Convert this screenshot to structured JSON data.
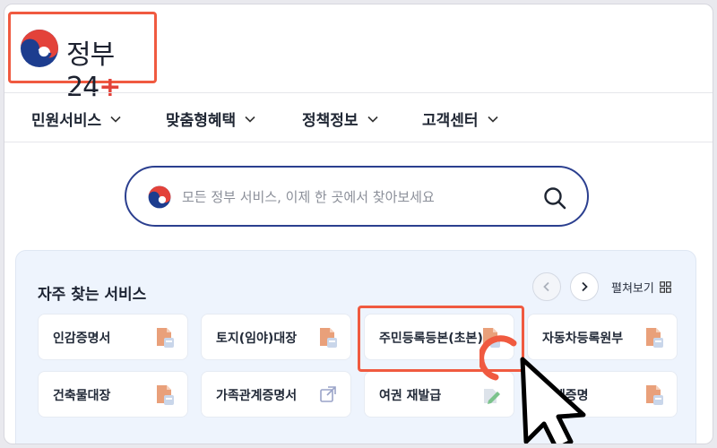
{
  "brand": {
    "name": "정부",
    "number": "24",
    "plus": "+"
  },
  "nav": {
    "items": [
      {
        "label": "민원서비스"
      },
      {
        "label": "맞춤형혜택"
      },
      {
        "label": "정책정보"
      },
      {
        "label": "고객센터"
      }
    ]
  },
  "search": {
    "placeholder": "모든 정부 서비스, 이제 한 곳에서 찾아보세요",
    "value": ""
  },
  "services": {
    "title": "자주 찾는 서비스",
    "expand_label": "펼쳐보기",
    "cards": [
      {
        "label": "인감증명서",
        "icon": "document-icon"
      },
      {
        "label": "토지(임야)대장",
        "icon": "document-icon"
      },
      {
        "label": "주민등록등본(초본)",
        "icon": "document-icon"
      },
      {
        "label": "자동차등록원부",
        "icon": "document-icon"
      },
      {
        "label": "건축물대장",
        "icon": "document-icon"
      },
      {
        "label": "가족관계증명서",
        "icon": "external-link-icon"
      },
      {
        "label": "여권 재발급",
        "icon": "pen-icon"
      },
      {
        "label": "납세증명",
        "icon": "document-icon"
      }
    ]
  },
  "colors": {
    "highlight": "#f05a40",
    "search_border": "#2b3f8f",
    "panel_bg": "#eef4fd",
    "brand_red": "#e3423a",
    "brand_blue": "#1d3d8f"
  }
}
